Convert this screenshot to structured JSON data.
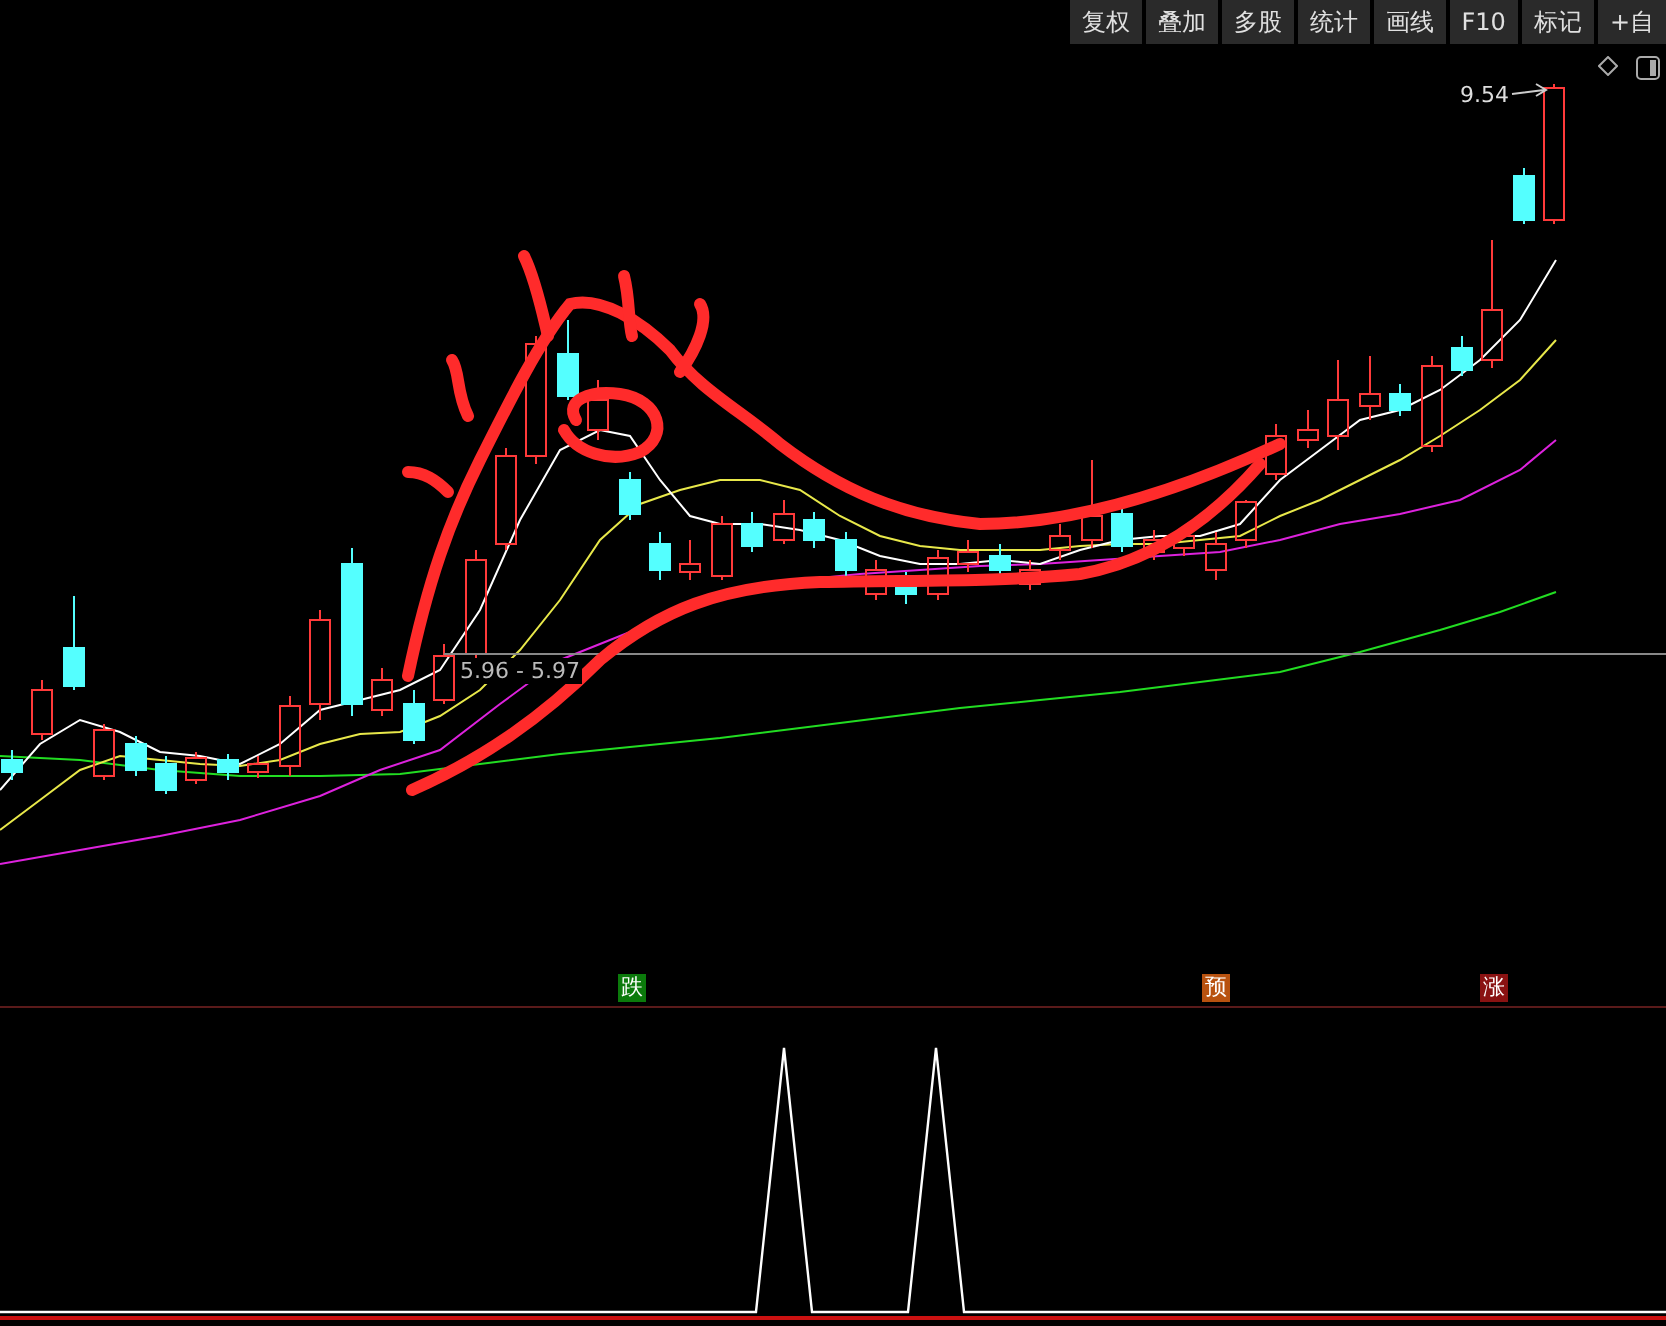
{
  "toolbar": {
    "buttons": [
      "复权",
      "叠加",
      "多股",
      "统计",
      "画线",
      "F10",
      "标记",
      "+自"
    ]
  },
  "chart": {
    "last_price_label": "9.54",
    "price_line_label": "5.96 - 5.97"
  },
  "signals": [
    {
      "label": "跌",
      "color": "#0b7a0b"
    },
    {
      "label": "预",
      "color": "#b8520f"
    },
    {
      "label": "涨",
      "color": "#8a1212"
    }
  ]
}
